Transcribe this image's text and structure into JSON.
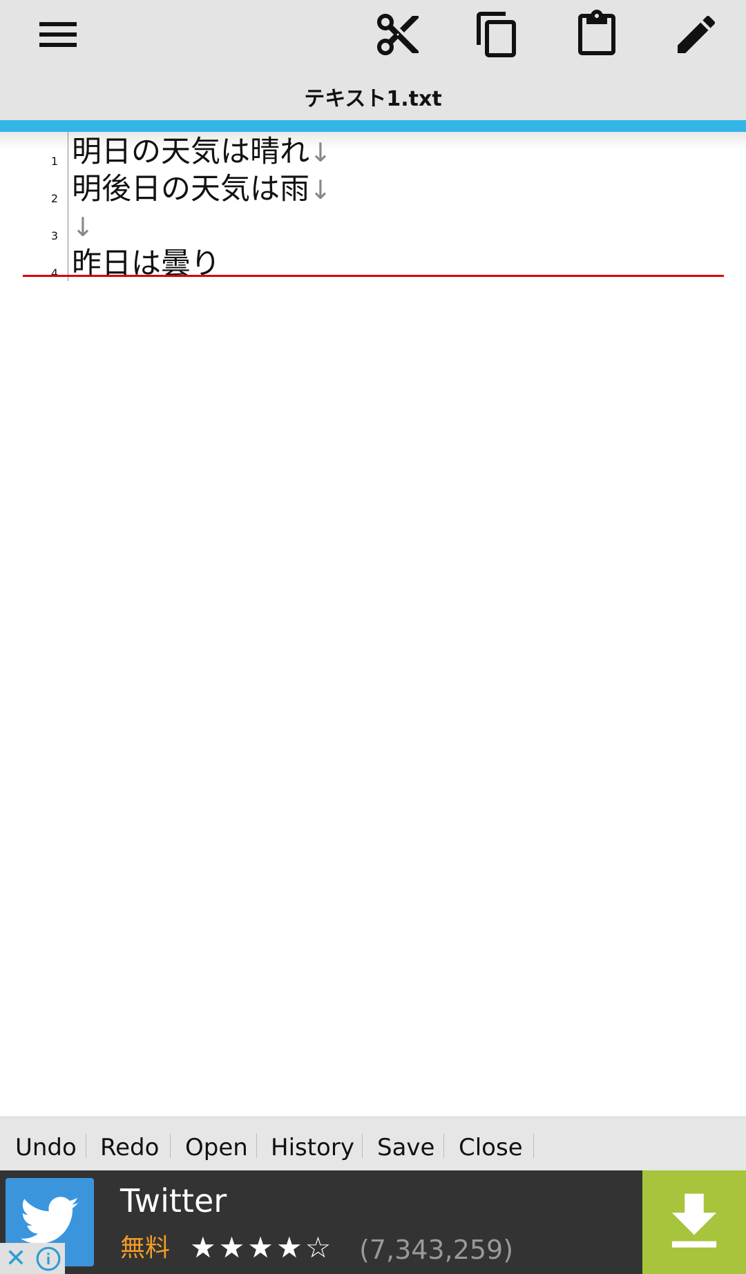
{
  "toolbar": {
    "title": "テキスト1.txt",
    "buttons": [
      "menu-icon",
      "cut-icon",
      "copy-icon",
      "paste-icon",
      "edit-icon"
    ]
  },
  "editor": {
    "lines": [
      {
        "num": "1",
        "text": "明日の天気は晴れ",
        "eol": "↓"
      },
      {
        "num": "2",
        "text": "明後日の天気は雨",
        "eol": "↓"
      },
      {
        "num": "3",
        "text": "",
        "eol": "↓"
      },
      {
        "num": "4",
        "text": "昨日は曇り",
        "eol": ""
      }
    ]
  },
  "bottombar": {
    "undo": "Undo",
    "redo": "Redo",
    "open": "Open",
    "history": "History",
    "save": "Save",
    "close": "Close"
  },
  "ad": {
    "app_name": "Twitter",
    "price": "無料",
    "stars": "★★★★☆",
    "rating_count": "(7,343,259)",
    "colors": {
      "background": "#333333",
      "download": "#a8c43c",
      "price": "#f39c27"
    }
  }
}
